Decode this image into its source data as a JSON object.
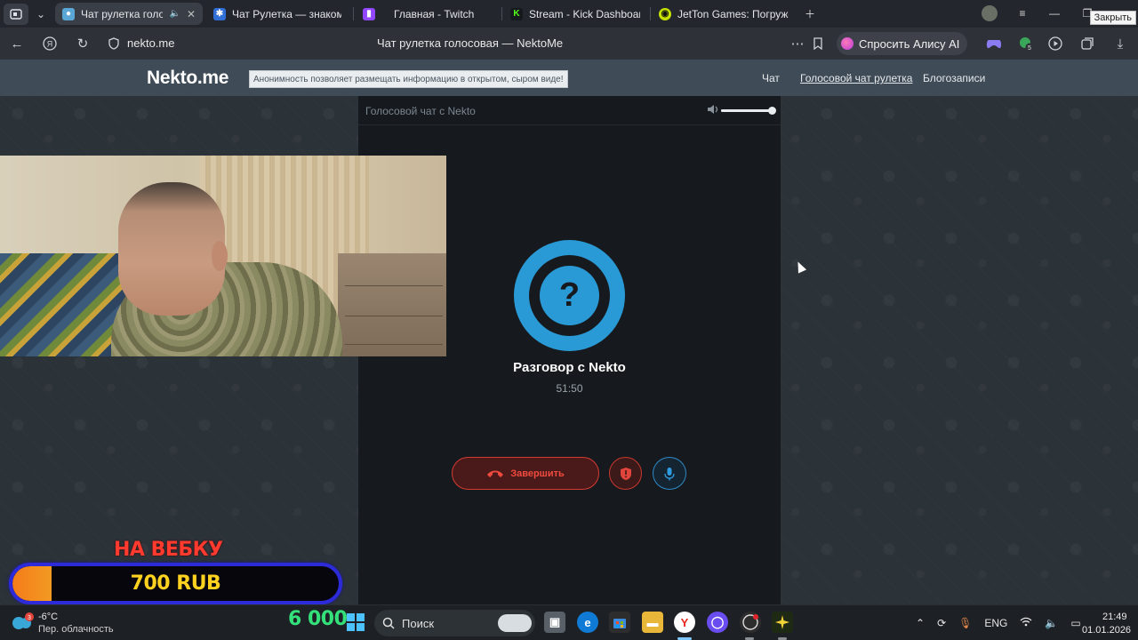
{
  "browser": {
    "tabs": [
      {
        "title": "Чат рулетка голосов",
        "active": true,
        "favicon": "nekto-icon"
      },
      {
        "title": "Чат Рулетка — знакомств",
        "active": false,
        "favicon": "chatrulet-icon"
      },
      {
        "title": "Главная - Twitch",
        "active": false,
        "favicon": "twitch-icon"
      },
      {
        "title": "Stream - Kick Dashboard",
        "active": false,
        "favicon": "kick-icon"
      },
      {
        "title": "JetTon Games: Погружен",
        "active": false,
        "favicon": "jetton-icon"
      }
    ],
    "close_tooltip": "Закрыть",
    "url": "nekto.me",
    "page_title": "Чат рулетка голосовая — NektoMe",
    "alice_label": "Спросить Алису AI",
    "extension_badge": "5"
  },
  "site": {
    "logo": "Nekto.me",
    "slogan": "Анонимность позволяет размещать информацию в открытом, сыром виде!",
    "nav": [
      {
        "label": "Чат",
        "current": false
      },
      {
        "label": "Голосовой чат рулетка",
        "current": true
      },
      {
        "label": "Блогозаписи",
        "current": false
      }
    ]
  },
  "call": {
    "panel_title": "Голосовой чат с Nekto",
    "volume_level": 1.0,
    "avatar_symbol": "?",
    "peer_name": "Разговор с Nekto",
    "timer": "51:50",
    "end_label": "Завершить"
  },
  "overlay": {
    "goal_label": "НА ВЕБКУ",
    "goal_amount": "700 RUB",
    "goal_progress": 0.12,
    "counter": "6 000"
  },
  "taskbar": {
    "weather_temp": "-6°C",
    "weather_desc": "Пер. облачность",
    "weather_badge": "3",
    "search_label": "Поиск",
    "lang": "ENG",
    "time": "21:49",
    "date": "01.01.2026"
  },
  "colors": {
    "accent_blue": "#2a9ad6",
    "danger_red": "#d43b33",
    "goal_orange": "#f57b1a",
    "goal_text": "#ffd21f",
    "counter_green": "#33e07a"
  }
}
